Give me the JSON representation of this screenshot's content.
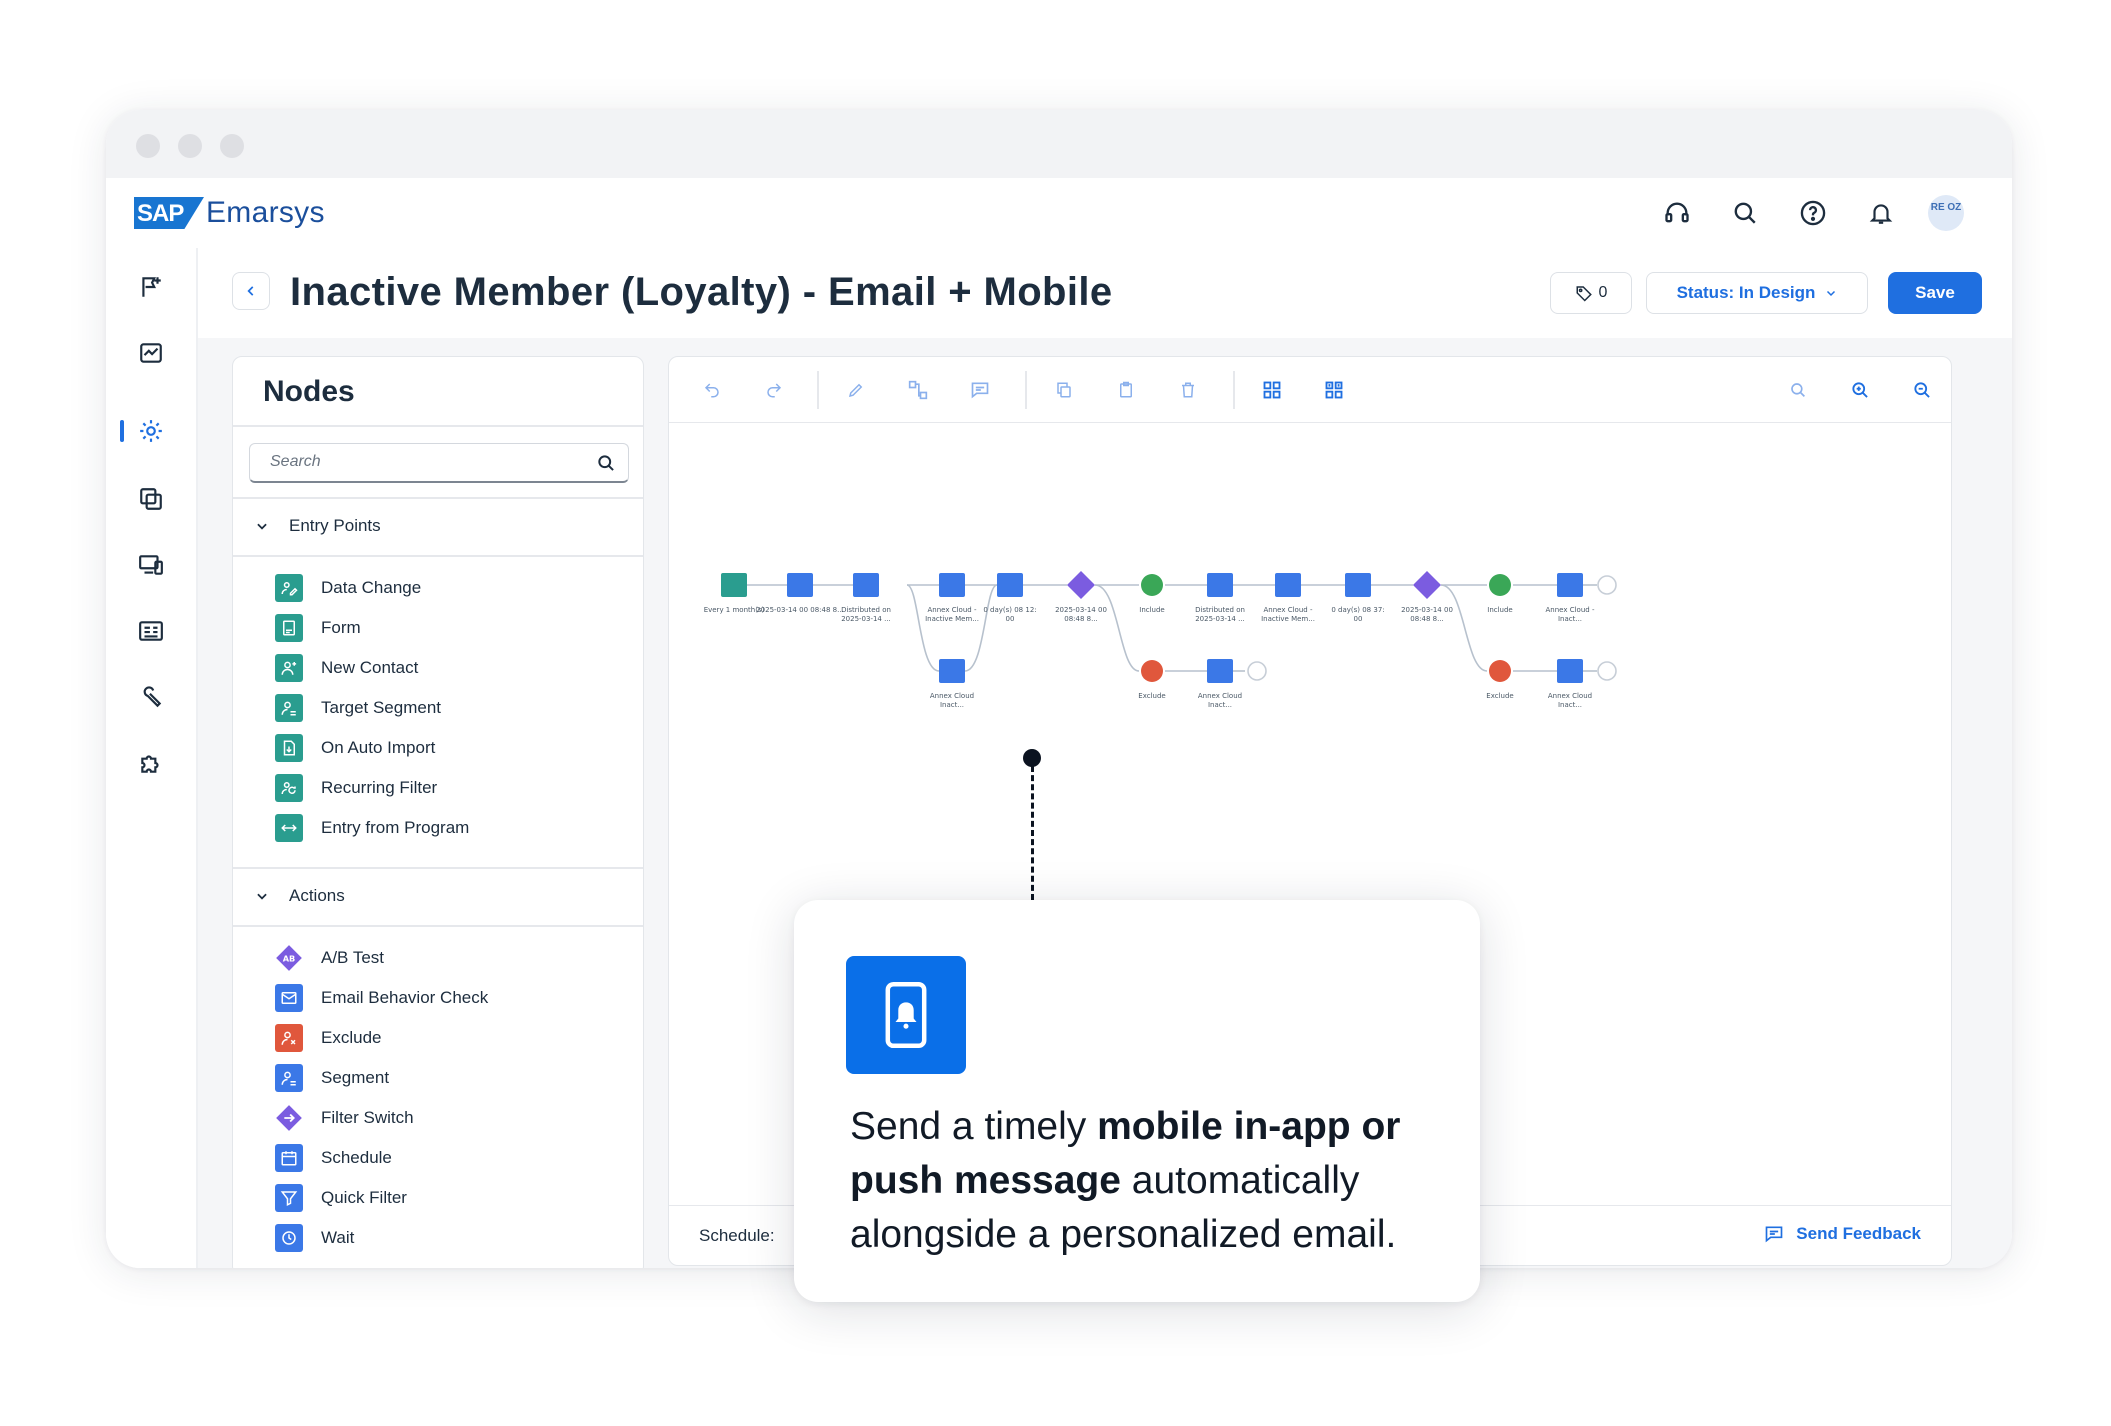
{
  "app": {
    "brand_logo": "SAP",
    "brand_name": "Emarsys",
    "avatar_initials": "RE OZ"
  },
  "header_icons": [
    "headset-icon",
    "search-icon",
    "help-icon",
    "bell-icon"
  ],
  "rail_icons": [
    "bookmark-flag-icon",
    "analytics-icon",
    "automation-icon",
    "gallery-icon",
    "devices-icon",
    "contact-card-icon",
    "wrench-icon",
    "puzzle-icon"
  ],
  "page": {
    "title": "Inactive Member (Loyalty) - Email + Mobile",
    "tag_count": "0",
    "status": "Status: In Design",
    "save_label": "Save"
  },
  "nodes_panel": {
    "title": "Nodes",
    "search_placeholder": "Search",
    "entry_points": {
      "label": "Entry Points",
      "items": [
        "Data Change",
        "Form",
        "New Contact",
        "Target Segment",
        "On Auto Import",
        "Recurring Filter",
        "Entry from Program"
      ]
    },
    "actions": {
      "label": "Actions",
      "items": [
        "A/B Test",
        "Email Behavior Check",
        "Exclude",
        "Segment",
        "Filter Switch",
        "Schedule",
        "Quick Filter",
        "Wait"
      ]
    }
  },
  "canvas": {
    "toolbar_icons": [
      "undo-icon",
      "redo-icon",
      "edit-icon",
      "connect-icon",
      "comment-icon",
      "copy-icon",
      "paste-icon",
      "delete-icon",
      "expand-icon",
      "collapse-icon",
      "search-icon",
      "zoom-in-icon",
      "zoom-out-icon"
    ],
    "flow_labels": {
      "n1": "Every 1 month(s)",
      "n2": "2025-03-14 00 08:48 8...",
      "n3a": "Distributed on",
      "n3b": "2025-03-14 ...",
      "n4a": "Annex Cloud -",
      "n4b": "Inactive Mem...",
      "n5a": "Annex Cloud",
      "n5b": "Inact...",
      "n6a": "0 day(s) 08 12:",
      "n6b": "00",
      "n7a": "2025-03-14 00",
      "n7b": "08:48 8...",
      "n8": "Include",
      "n9": "Exclude",
      "n10a": "Distributed on",
      "n10b": "2025-03-14 ...",
      "n11a": "Annex Cloud",
      "n11b": "Inact...",
      "n12a": "Annex Cloud -",
      "n12b": "Inactive Mem...",
      "n13a": "0 day(s) 08 37:",
      "n13b": "00",
      "n14a": "2025-03-14 00",
      "n14b": "08:48 8...",
      "n15": "Include",
      "n16": "Exclude",
      "n17a": "Annex Cloud -",
      "n17b": "Inact...",
      "n18a": "Annex Cloud",
      "n18b": "Inact..."
    },
    "schedule_label": "Schedule:",
    "feedback_label": "Send Feedback"
  },
  "callout": {
    "text_1": "Send a timely ",
    "bold_1": "mobile in-app or push message",
    "text_2": " automatically alongside a personalized email.",
    "icon": "mobile-push-icon"
  },
  "colors": {
    "accent": "#1f6fe0",
    "teal_node": "#2a9d8f",
    "blue_node": "#3b78e7",
    "purple_node": "#7b5ce0",
    "green_include": "#3aa757",
    "red_exclude": "#e0573c",
    "callout_icon_bg": "#0a6fe8"
  }
}
